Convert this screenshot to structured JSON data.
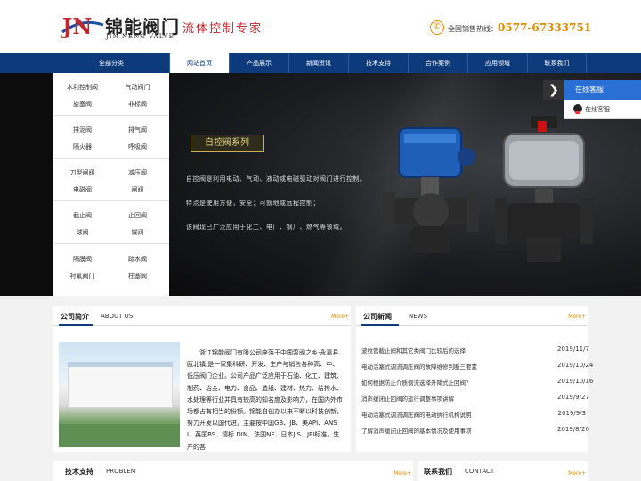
{
  "header": {
    "logo_mark": "JN",
    "brand_cn": "锦能阀门",
    "brand_en": "JIN NENG VALVE",
    "slogan": "流体控制专家",
    "hotline_label": "全国销售热线：",
    "hotline_number": "0577-67333751",
    "colors": {
      "brand_blue": "#0d3a7a",
      "accent_orange": "#e08a00",
      "slogan_red": "#c1272d"
    }
  },
  "nav": {
    "category_label": "全部分类",
    "items": [
      {
        "label": "网站首页",
        "active": true
      },
      {
        "label": "产品展示",
        "active": false
      },
      {
        "label": "新闻资讯",
        "active": false
      },
      {
        "label": "技术支持",
        "active": false
      },
      {
        "label": "合作案例",
        "active": false
      },
      {
        "label": "应用领域",
        "active": false
      },
      {
        "label": "联系我们",
        "active": false
      }
    ]
  },
  "sidebar": {
    "groups": [
      [
        "水利控制阀",
        "气动阀门",
        "旋塞阀",
        "非标阀"
      ],
      [
        "排泥阀",
        "排气阀",
        "隔火器",
        "呼吸阀"
      ],
      [
        "刀型闸阀",
        "减压阀",
        "电磁阀",
        "闸阀"
      ],
      [
        "截止阀",
        "止回阀",
        "球阀",
        "蝶阀"
      ],
      [
        "隔膜阀",
        "疏水阀",
        "衬氟阀门",
        "柱塞阀"
      ]
    ]
  },
  "banner": {
    "tag": "自控阀系列",
    "lines": [
      "自控阀是利用电动、气动、液动或电磁驱动对阀门进行控制。",
      "特点是使用方便，安全；可就地或远程控制；",
      "该阀现已广泛应用于化工、电厂、钢厂、燃气等领域。"
    ]
  },
  "chat": {
    "title": "在线客服",
    "item": "在线客服"
  },
  "about": {
    "title": "公司简介",
    "subtitle": "ABOUT US",
    "more": "More+",
    "text": "浙江锦能阀门有限公司座落于中国泵阀之乡-永嘉县瓯北镇,是一家集科研、开发、生产与销售各种高、中、低压阀门企业。公司产品广泛应用于石油、化工、建筑、制药、冶金、电力、食品、造纸、建材、热力、给排水、水处理等行业并具有较高的知名度及影响力，在国内外市场都占有相当的份额。锦能自创办以来不断以科技创新，努力开发以国代进，主要按中国GB、JB、美API、ANSI、英国BS、德标 DIN、法国NF、日本JIS、JPI标准。生产的各"
  },
  "news": {
    "title": "公司新闻",
    "subtitle": "NEWS",
    "more": "More+",
    "items": [
      {
        "title": "波纹管截止阀和其它类阀门比较后的选择",
        "date": "2019/11/7"
      },
      {
        "title": "电动活塞式调流调压阀的故障维修判断三要素",
        "date": "2019/10/24"
      },
      {
        "title": "如何根据防止介质倒流选择升降式止回阀？",
        "date": "2019/10/16"
      },
      {
        "title": "消声缓闭止回阀的运行调整事项讲解",
        "date": "2019/9/27"
      },
      {
        "title": "电动活塞式调流调压阀的电动执行机构说明",
        "date": "2019/9/3"
      },
      {
        "title": "了解消声缓闭止回阀的基本情况及使用事项",
        "date": "2019/8/20"
      }
    ]
  },
  "tech": {
    "title": "技术支持",
    "subtitle": "PROBLEM",
    "more": "More+"
  },
  "contact": {
    "title": "联系我们",
    "subtitle": "CONTACT",
    "more": "More+"
  }
}
